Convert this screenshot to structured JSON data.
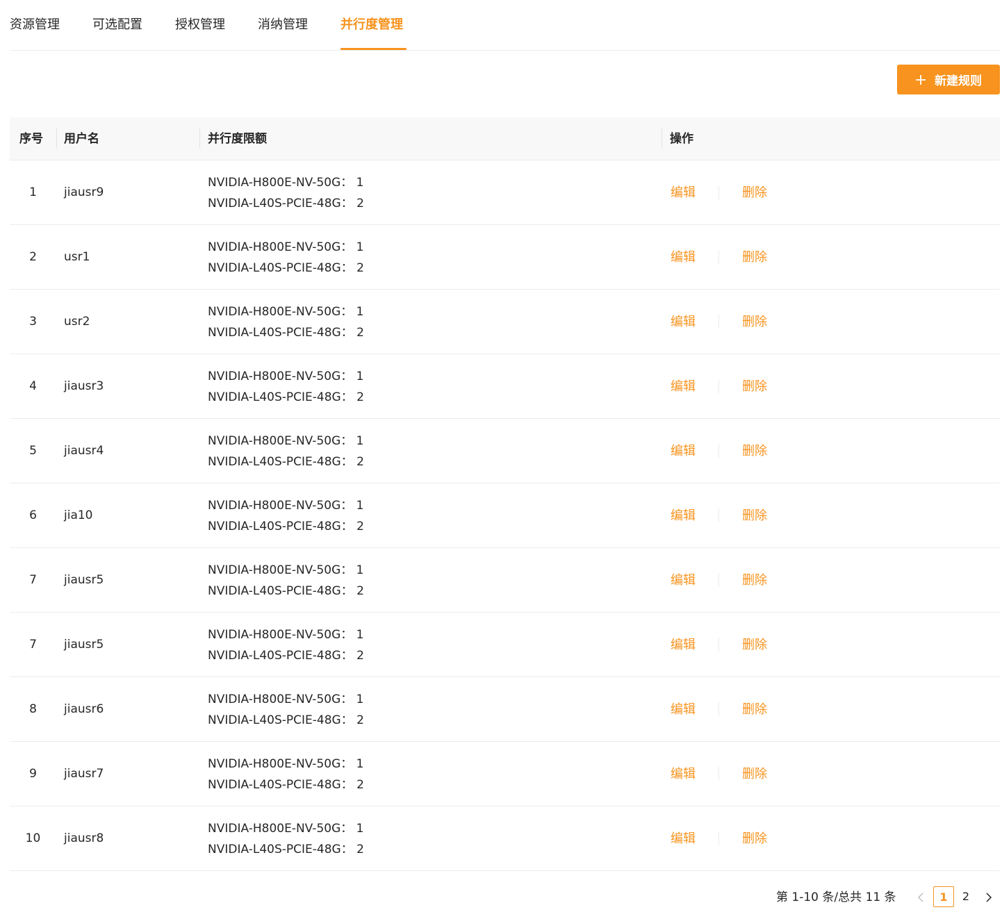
{
  "tabs": [
    {
      "label": "资源管理"
    },
    {
      "label": "可选配置"
    },
    {
      "label": "授权管理"
    },
    {
      "label": "消纳管理"
    },
    {
      "label": "并行度管理",
      "active": true
    }
  ],
  "toolbar": {
    "new_rule_label": "新建规则"
  },
  "table": {
    "headers": {
      "index": "序号",
      "username": "用户名",
      "quota": "并行度限额",
      "actions": "操作"
    },
    "rows": [
      {
        "index": "1",
        "username": "jiausr9",
        "quota": [
          "NVIDIA-H800E-NV-50G： 1",
          "NVIDIA-L40S-PCIE-48G： 2"
        ],
        "edit": "编辑",
        "delete": "删除"
      },
      {
        "index": "2",
        "username": "usr1",
        "quota": [
          "NVIDIA-H800E-NV-50G： 1",
          "NVIDIA-L40S-PCIE-48G： 2"
        ],
        "edit": "编辑",
        "delete": "删除"
      },
      {
        "index": "3",
        "username": "usr2",
        "quota": [
          "NVIDIA-H800E-NV-50G： 1",
          "NVIDIA-L40S-PCIE-48G： 2"
        ],
        "edit": "编辑",
        "delete": "删除"
      },
      {
        "index": "4",
        "username": "jiausr3",
        "quota": [
          "NVIDIA-H800E-NV-50G： 1",
          "NVIDIA-L40S-PCIE-48G： 2"
        ],
        "edit": "编辑",
        "delete": "删除"
      },
      {
        "index": "5",
        "username": "jiausr4",
        "quota": [
          "NVIDIA-H800E-NV-50G： 1",
          "NVIDIA-L40S-PCIE-48G： 2"
        ],
        "edit": "编辑",
        "delete": "删除"
      },
      {
        "index": "6",
        "username": "jia10",
        "quota": [
          "NVIDIA-H800E-NV-50G： 1",
          "NVIDIA-L40S-PCIE-48G： 2"
        ],
        "edit": "编辑",
        "delete": "删除"
      },
      {
        "index": "7",
        "username": "jiausr5",
        "quota": [
          "NVIDIA-H800E-NV-50G： 1",
          "NVIDIA-L40S-PCIE-48G： 2"
        ],
        "edit": "编辑",
        "delete": "删除"
      },
      {
        "index": "7",
        "username": "jiausr5",
        "quota": [
          "NVIDIA-H800E-NV-50G： 1",
          "NVIDIA-L40S-PCIE-48G： 2"
        ],
        "edit": "编辑",
        "delete": "删除"
      },
      {
        "index": "8",
        "username": "jiausr6",
        "quota": [
          "NVIDIA-H800E-NV-50G： 1",
          "NVIDIA-L40S-PCIE-48G： 2"
        ],
        "edit": "编辑",
        "delete": "删除"
      },
      {
        "index": "9",
        "username": "jiausr7",
        "quota": [
          "NVIDIA-H800E-NV-50G： 1",
          "NVIDIA-L40S-PCIE-48G： 2"
        ],
        "edit": "编辑",
        "delete": "删除"
      },
      {
        "index": "10",
        "username": "jiausr8",
        "quota": [
          "NVIDIA-H800E-NV-50G： 1",
          "NVIDIA-L40S-PCIE-48G： 2"
        ],
        "edit": "编辑",
        "delete": "删除"
      }
    ]
  },
  "pagination": {
    "total_text": "第 1-10 条/总共 11 条",
    "pages": [
      "1",
      "2"
    ],
    "current_page": "1"
  },
  "colors": {
    "accent": "#f7931e",
    "text": "#262626",
    "header_bg": "#f8f8f8",
    "border": "#ececec"
  },
  "icons": {
    "new_button": "plus-icon",
    "prev": "chevron-left-icon",
    "next": "chevron-right-icon"
  }
}
